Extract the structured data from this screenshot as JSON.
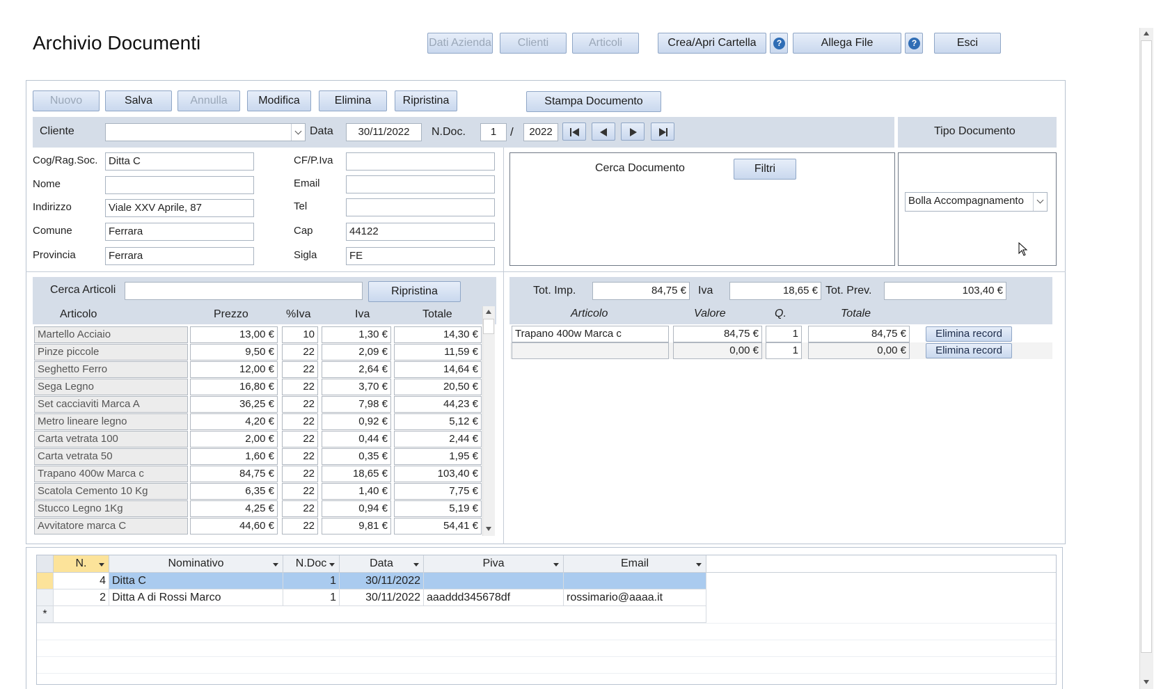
{
  "window": {
    "title": "Archivio  Documenti"
  },
  "toolbar": {
    "dati_azienda": "Dati Azienda",
    "clienti": "Clienti",
    "articoli": "Articoli",
    "crea_cartella": "Crea/Apri Cartella",
    "allega_file": "Allega File",
    "esci": "Esci",
    "help": "?"
  },
  "actions": {
    "nuovo": "Nuovo",
    "salva": "Salva",
    "annulla": "Annulla",
    "modifica": "Modifica",
    "elimina": "Elimina",
    "ripristina": "Ripristina",
    "stampa": "Stampa Documento"
  },
  "header": {
    "cliente_label": "Cliente",
    "cliente_value": "",
    "data_label": "Data",
    "data_value": "30/11/2022",
    "ndoc_label": "N.Doc.",
    "ndoc_value": "1",
    "slash": "/",
    "anno_value": "2022",
    "tipo_documento_label": "Tipo Documento",
    "tipo_documento_value": "Bolla Accompagnamento"
  },
  "customer": {
    "cog_label": "Cog/Rag.Soc.",
    "cog_value": "Ditta C",
    "nome_label": "Nome",
    "nome_value": "",
    "indirizzo_label": "Indirizzo",
    "indirizzo_value": "Viale XXV Aprile, 87",
    "comune_label": "Comune",
    "comune_value": "Ferrara",
    "provincia_label": "Provincia",
    "provincia_value": "Ferrara",
    "cf_label": "CF/P.Iva",
    "cf_value": "",
    "email_label": "Email",
    "email_value": "",
    "tel_label": "Tel",
    "tel_value": "",
    "cap_label": "Cap",
    "cap_value": "44122",
    "sigla_label": "Sigla",
    "sigla_value": "FE"
  },
  "search_doc": {
    "label": "Cerca Documento",
    "filtri": "Filtri"
  },
  "articles": {
    "search_label": "Cerca Articoli",
    "search_value": "",
    "ripristina": "Ripristina",
    "columns": {
      "articolo": "Articolo",
      "prezzo": "Prezzo",
      "piva": "%Iva",
      "iva": "Iva",
      "totale": "Totale"
    },
    "rows": [
      {
        "name": "Martello Acciaio",
        "prezzo": "13,00 €",
        "piva": "10",
        "iva": "1,30 €",
        "totale": "14,30 €"
      },
      {
        "name": "Pinze piccole",
        "prezzo": "9,50 €",
        "piva": "22",
        "iva": "2,09 €",
        "totale": "11,59 €"
      },
      {
        "name": "Seghetto Ferro",
        "prezzo": "12,00 €",
        "piva": "22",
        "iva": "2,64 €",
        "totale": "14,64 €"
      },
      {
        "name": "Sega Legno",
        "prezzo": "16,80 €",
        "piva": "22",
        "iva": "3,70 €",
        "totale": "20,50 €"
      },
      {
        "name": "Set cacciaviti Marca A",
        "prezzo": "36,25 €",
        "piva": "22",
        "iva": "7,98 €",
        "totale": "44,23 €"
      },
      {
        "name": "Metro lineare legno",
        "prezzo": "4,20 €",
        "piva": "22",
        "iva": "0,92 €",
        "totale": "5,12 €"
      },
      {
        "name": "Carta vetrata 100",
        "prezzo": "2,00 €",
        "piva": "22",
        "iva": "0,44 €",
        "totale": "2,44 €"
      },
      {
        "name": "Carta vetrata 50",
        "prezzo": "1,60 €",
        "piva": "22",
        "iva": "0,35 €",
        "totale": "1,95 €"
      },
      {
        "name": "Trapano 400w Marca c",
        "prezzo": "84,75 €",
        "piva": "22",
        "iva": "18,65 €",
        "totale": "103,40 €"
      },
      {
        "name": "Scatola Cemento 10 Kg",
        "prezzo": "6,35 €",
        "piva": "22",
        "iva": "1,40 €",
        "totale": "7,75 €"
      },
      {
        "name": "Stucco Legno 1Kg",
        "prezzo": "4,25 €",
        "piva": "22",
        "iva": "0,94 €",
        "totale": "5,19 €"
      },
      {
        "name": "Avvitatore marca C",
        "prezzo": "44,60 €",
        "piva": "22",
        "iva": "9,81 €",
        "totale": "54,41 €"
      }
    ]
  },
  "totals": {
    "imp_label": "Tot. Imp.",
    "imp_value": "84,75 €",
    "iva_label": "Iva",
    "iva_value": "18,65 €",
    "prev_label": "Tot. Prev.",
    "prev_value": "103,40 €"
  },
  "doc_lines": {
    "columns": {
      "articolo": "Articolo",
      "valore": "Valore",
      "q": "Q.",
      "totale": "Totale"
    },
    "delete_label": "Elimina record",
    "rows": [
      {
        "articolo": "Trapano 400w Marca c",
        "valore": "84,75 €",
        "q": "1",
        "totale": "84,75 €"
      },
      {
        "articolo": "",
        "valore": "0,00 €",
        "q": "1",
        "totale": "0,00 €"
      }
    ]
  },
  "doc_grid": {
    "columns": {
      "n": "N.",
      "nominativo": "Nominativo",
      "ndoc": "N.Doc",
      "data": "Data",
      "piva": "Piva",
      "email": "Email"
    },
    "rows": [
      {
        "n": "4",
        "nominativo": "Ditta C",
        "ndoc": "1",
        "data": "30/11/2022",
        "piva": "",
        "email": ""
      },
      {
        "n": "2",
        "nominativo": "Ditta A di Rossi Marco",
        "ndoc": "1",
        "data": "30/11/2022",
        "piva": "aaaddd345678df",
        "email": "rossimario@aaaa.it"
      }
    ],
    "new_row_marker": "*"
  }
}
